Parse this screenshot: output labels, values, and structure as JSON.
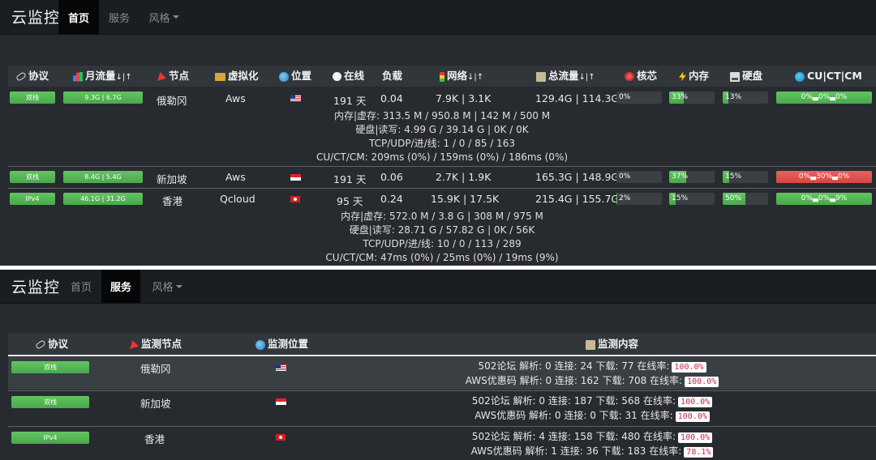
{
  "brand": "云监控",
  "nav": {
    "home": "首页",
    "service": "服务",
    "style": "风格"
  },
  "colors": {
    "background": "#272b30",
    "navbar": "#1b1e21",
    "green": "#5cb85c",
    "red": "#d9534f",
    "pill_text": "#c7254e"
  },
  "panel1": {
    "headers": {
      "protocol": "协议",
      "monthly": "月流量",
      "node": "节点",
      "virt": "虚拟化",
      "location": "位置",
      "online": "在线",
      "load": "负载",
      "network": "网络",
      "total": "总流量",
      "cpu": "核芯",
      "mem": "内存",
      "disk": "硬盘",
      "cucm": "CU|CT|CM",
      "sort_arrows": "↓|↑"
    },
    "rows": [
      {
        "protocol": "双栈",
        "monthly": "9.3G | 6.7G",
        "node": "俄勒冈",
        "virt": "Aws",
        "flag": "us-flag-icon",
        "online": "191 天",
        "load": "0.04",
        "network": "7.9K | 3.1K",
        "total": "129.4G | 114.3G",
        "cpu": "0%",
        "cpu_pct": 0,
        "mem": "33%",
        "mem_pct": 33,
        "disk": "13%",
        "disk_pct": 13,
        "cucm": "0%▃0%▃0%",
        "cucm_status": "ok",
        "details": [
          "内存|虚存: 313.5 M / 950.8 M | 142 M / 500 M",
          "硬盘|读写: 4.99 G / 39.14 G | 0K / 0K",
          "TCP/UDP/进/线: 1 / 0 / 85 / 163",
          "CU/CT/CM: 209ms (0%) / 159ms (0%) / 186ms (0%)"
        ]
      },
      {
        "protocol": "双栈",
        "monthly": "8.4G | 5.4G",
        "node": "新加坡",
        "virt": "Aws",
        "flag": "sg-flag-icon",
        "online": "191 天",
        "load": "0.06",
        "network": "2.7K | 1.9K",
        "total": "165.3G | 148.9G",
        "cpu": "0%",
        "cpu_pct": 0,
        "mem": "37%",
        "mem_pct": 37,
        "disk": "15%",
        "disk_pct": 15,
        "cucm": "0%▃30%▃0%",
        "cucm_status": "bad",
        "details": []
      },
      {
        "protocol": "IPv4",
        "monthly": "46.1G | 31.2G",
        "node": "香港",
        "virt": "Qcloud",
        "flag": "hk-flag-icon",
        "online": "95 天",
        "load": "0.24",
        "network": "15.9K | 17.5K",
        "total": "215.4G | 155.7G",
        "cpu": "2%",
        "cpu_pct": 2,
        "mem": "15%",
        "mem_pct": 15,
        "disk": "50%",
        "disk_pct": 50,
        "cucm": "0%▃0%▃9%",
        "cucm_status": "ok",
        "details": [
          "内存|虚存: 572.0 M / 3.8 G | 308 M / 975 M",
          "硬盘|读写: 28.71 G / 57.82 G | 0K / 56K",
          "TCP/UDP/进/线: 10 / 0 / 113 / 289",
          "CU/CT/CM: 47ms (0%) / 25ms (0%) / 19ms (9%)"
        ]
      }
    ]
  },
  "panel2": {
    "headers": {
      "protocol": "协议",
      "node": "监测节点",
      "location": "监测位置",
      "content": "监测内容"
    },
    "rows": [
      {
        "protocol": "双栈",
        "node": "俄勒冈",
        "flag": "us-flag-icon",
        "lines": [
          {
            "text": "502论坛 解析: 0 连接: 24 下载: 77 在线率:",
            "rate": "100.0%"
          },
          {
            "text": "AWS优惠码 解析: 0 连接: 162 下载: 708 在线率:",
            "rate": "100.0%"
          }
        ]
      },
      {
        "protocol": "双栈",
        "node": "新加坡",
        "flag": "sg-flag-icon",
        "lines": [
          {
            "text": "502论坛 解析: 0 连接: 187 下载: 568 在线率:",
            "rate": "100.0%"
          },
          {
            "text": "AWS优惠码 解析: 0 连接: 0 下载: 31 在线率:",
            "rate": "100.0%"
          }
        ]
      },
      {
        "protocol": "IPv4",
        "node": "香港",
        "flag": "hk-flag-icon",
        "lines": [
          {
            "text": "502论坛 解析: 4 连接: 158 下载: 480 在线率:",
            "rate": "100.0%"
          },
          {
            "text": "AWS优惠码 解析: 1 连接: 36 下载: 183 在线率:",
            "rate": "78.1%"
          }
        ]
      }
    ]
  }
}
